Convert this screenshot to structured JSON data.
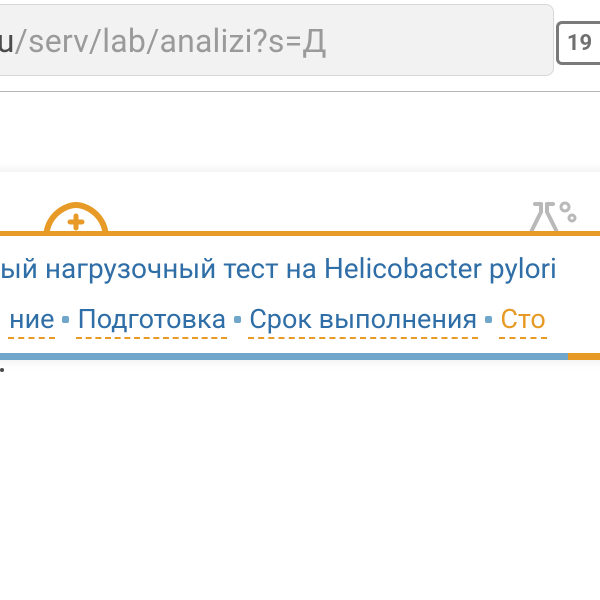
{
  "browser": {
    "url_host": "hmi.ru",
    "url_path": "/serv/lab/analizi?s=Д",
    "tab_count": "19"
  },
  "page": {
    "title": "ый нагрузочный тест на Helicobacter pylori",
    "tabs": [
      {
        "label": "ние",
        "active": false
      },
      {
        "label": "Подготовка",
        "active": false
      },
      {
        "label": "Срок выполнения",
        "active": false
      },
      {
        "label": "Сто",
        "active": true
      }
    ]
  },
  "icons": {
    "nurse": "nurse-cap-icon",
    "flask": "lab-flask-icon"
  },
  "colors": {
    "accent": "#e79a25",
    "link": "#2f6ea6",
    "progress_bg": "#6fa6c9"
  }
}
